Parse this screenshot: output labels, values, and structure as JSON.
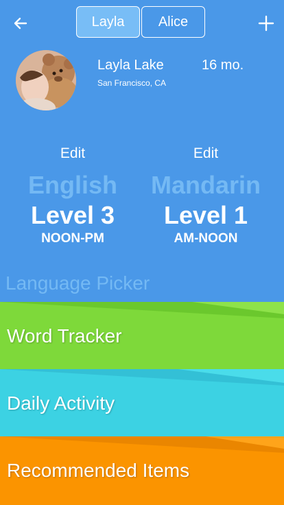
{
  "header": {
    "tabs": [
      {
        "label": "Layla",
        "active": true
      },
      {
        "label": "Alice",
        "active": false
      }
    ]
  },
  "profile": {
    "name": "Layla Lake",
    "age": "16 mo.",
    "location": "San Francisco, CA"
  },
  "languages": [
    {
      "edit_label": "Edit",
      "language": "English",
      "level": "Level 3",
      "time": "NOON-PM"
    },
    {
      "edit_label": "Edit",
      "language": "Mandarin",
      "level": "Level 1",
      "time": "AM-NOON"
    }
  ],
  "picker_label": "Language Picker",
  "sections": [
    {
      "label": "Word Tracker",
      "color": "#7ed93a"
    },
    {
      "label": "Daily Activity",
      "color": "#3cd2e3"
    },
    {
      "label": "Recommended Items",
      "color": "#fb9400"
    }
  ],
  "colors": {
    "background": "#4a98e8",
    "accent_light": "#74b9f4",
    "tab_active": "#78bdf6"
  },
  "icons": {
    "back": "back-arrow-icon",
    "add": "plus-icon"
  }
}
